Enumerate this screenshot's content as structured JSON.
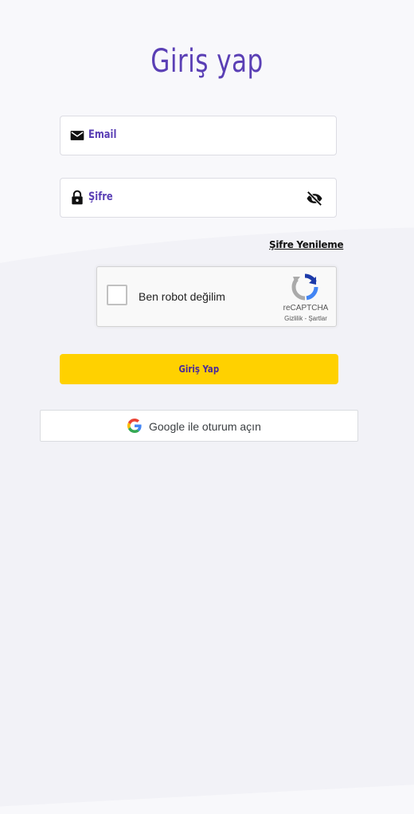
{
  "page": {
    "title": "Giriş yap"
  },
  "email": {
    "label": "Email",
    "icon": "mail-icon"
  },
  "password": {
    "label": "Şifre",
    "icon": "lock-icon",
    "toggle_icon": "eye-off-icon"
  },
  "forgot_link": "Şifre Yenileme",
  "captcha": {
    "label": "Ben robot değilim",
    "brand": "reCAPTCHA",
    "privacy": "Gizlilik",
    "separator": "-",
    "terms": "Şartlar",
    "icon": "recaptcha-icon"
  },
  "submit_button": "Giriş Yap",
  "google_button": {
    "label": "Google ile oturum açın",
    "icon": "google-icon"
  },
  "colors": {
    "accent": "#5a3fb5",
    "button": "#ffd100",
    "background": "#f8f8fb"
  }
}
